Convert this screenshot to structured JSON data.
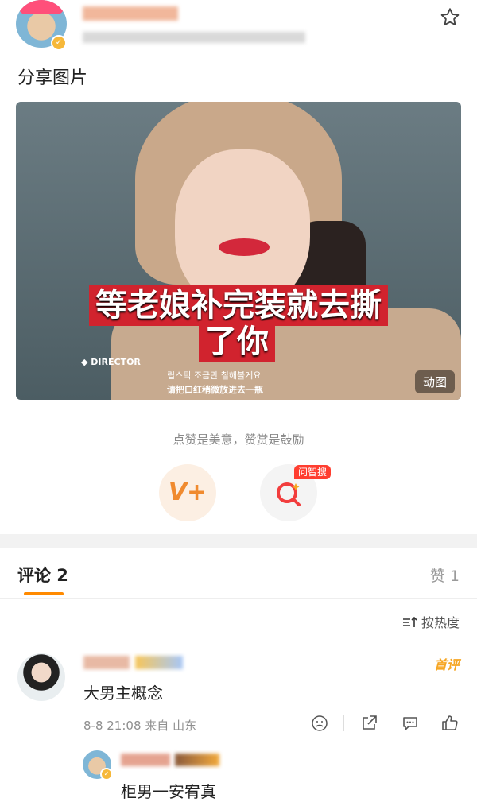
{
  "post": {
    "author_name": "",
    "text": "分享图片",
    "avatar_sticker": "",
    "icons": {
      "favorite": "star-outline-icon",
      "verified": "verified-badge-icon"
    }
  },
  "media": {
    "subtitle_line1": "等老娘补完装就去撕",
    "subtitle_line2": "了你",
    "director_label": "DIRECTOR",
    "korean_subtitle": "립스틱 조금만 칠해볼게요",
    "chinese_subtitle": "请把口红稍微放进去一瓶",
    "gif_badge": "动图"
  },
  "reward": {
    "caption": "点赞是美意，赞赏是鼓励",
    "zhisou_badge": "问智搜",
    "vplus_icon": "V+"
  },
  "tabs": {
    "comments": "评论 2",
    "likes": "赞 1"
  },
  "sort": {
    "label": "按热度",
    "icon": "sort-icon"
  },
  "comments": [
    {
      "text": "大男主概念",
      "tag": "首评",
      "time": "8-8 21:08",
      "source_prefix": "来自",
      "location": "山东",
      "actions": [
        "dislike-icon",
        "share-icon",
        "reply-icon",
        "like-icon"
      ]
    }
  ],
  "reply": {
    "text": "柜男一安宥真"
  },
  "colors": {
    "accent": "#ff8a00",
    "gif_overlay": "#00000073",
    "subtitle_red": "#d1232e",
    "badge_red": "#ff3e30"
  }
}
